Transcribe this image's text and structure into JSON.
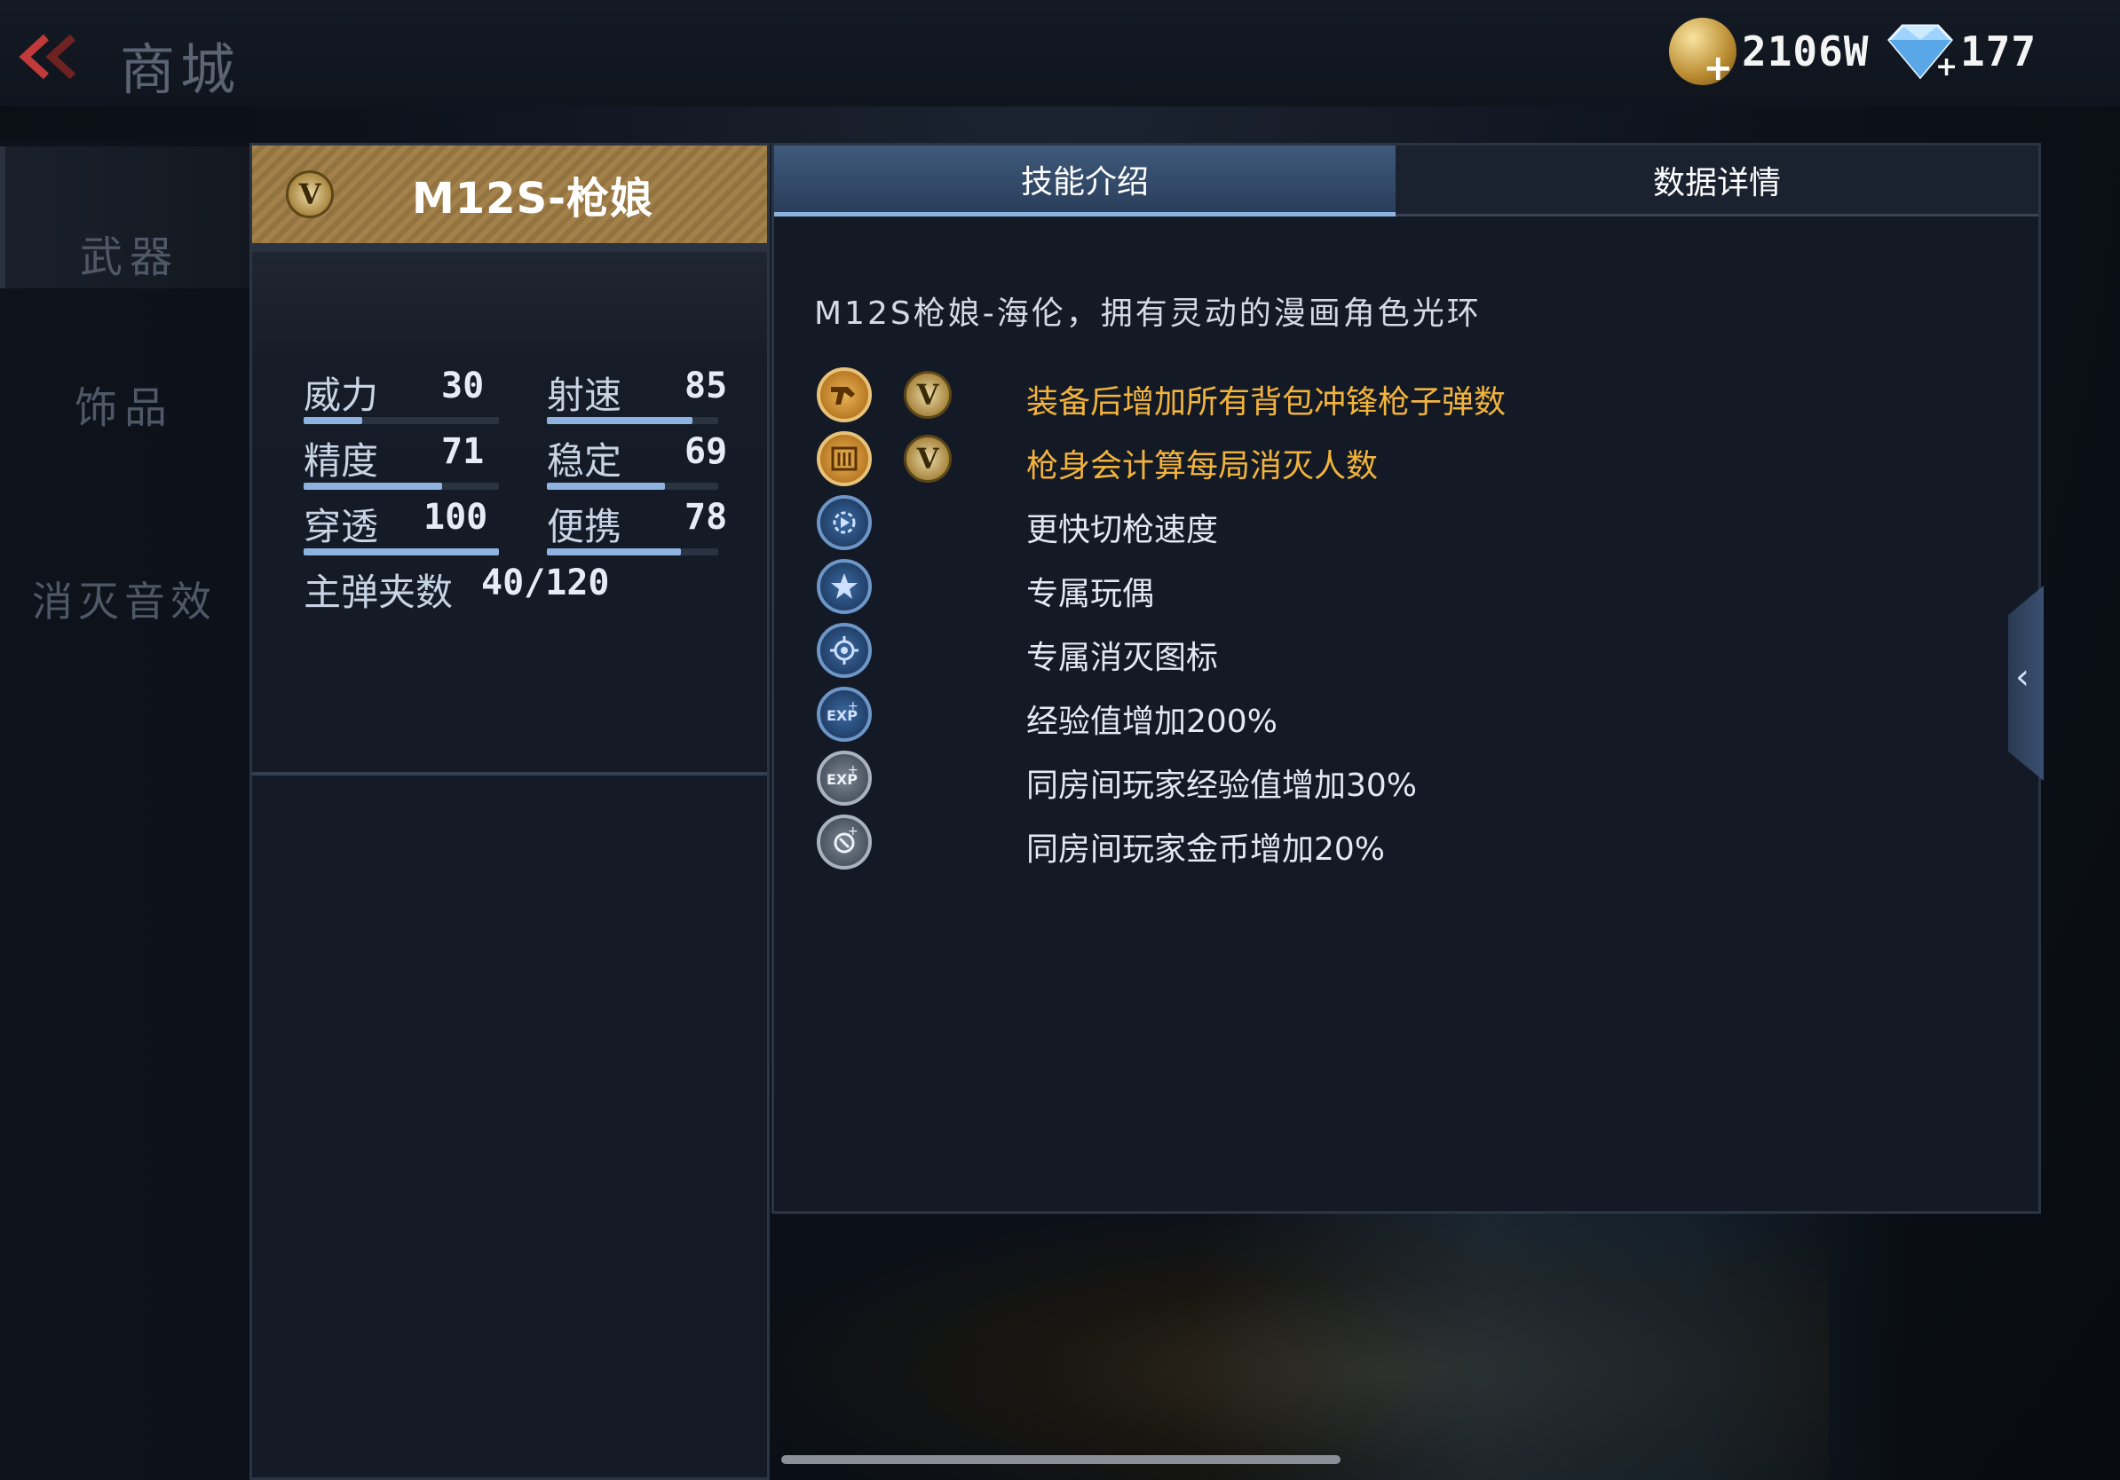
{
  "header": {
    "title": "商城",
    "coins": "2106W",
    "diamonds": "177"
  },
  "sidebar": {
    "items": [
      {
        "label": "武器"
      },
      {
        "label": "饰品"
      },
      {
        "label": "消灭音效"
      }
    ]
  },
  "weapon": {
    "badge": "V",
    "name": "M12S-枪娘",
    "stats": [
      {
        "label": "威力",
        "value": "30",
        "fill": 0.3
      },
      {
        "label": "射速",
        "value": "85",
        "fill": 0.85
      },
      {
        "label": "精度",
        "value": "71",
        "fill": 0.71
      },
      {
        "label": "稳定",
        "value": "69",
        "fill": 0.69
      },
      {
        "label": "穿透",
        "value": "100",
        "fill": 1.0
      },
      {
        "label": "便携",
        "value": "78",
        "fill": 0.78
      }
    ],
    "ammo_label": "主弹夹数",
    "ammo_value": "40/120"
  },
  "tabs": [
    {
      "label": "技能介绍",
      "active": true
    },
    {
      "label": "数据详情",
      "active": false
    }
  ],
  "skills": {
    "description": "M12S枪娘-海伦，拥有灵动的漫画角色光环",
    "items": [
      {
        "text": "装备后增加所有背包冲锋枪子弹数",
        "icon": "gun-icon",
        "style": "gold",
        "vip": "V"
      },
      {
        "text": "枪身会计算每局消灭人数",
        "icon": "counter-icon",
        "style": "gold",
        "vip": "V"
      },
      {
        "text": "更快切枪速度",
        "icon": "swap-speed-icon",
        "style": "blue"
      },
      {
        "text": "专属玩偶",
        "icon": "star-icon",
        "style": "blue"
      },
      {
        "text": "专属消灭图标",
        "icon": "kill-mark-icon",
        "style": "blue"
      },
      {
        "text": "经验值增加200%",
        "icon": "exp-icon",
        "style": "blue"
      },
      {
        "text": "同房间玩家经验值增加30%",
        "icon": "room-exp-icon",
        "style": "grey"
      },
      {
        "text": "同房间玩家金币增加20%",
        "icon": "room-coin-icon",
        "style": "grey"
      }
    ]
  },
  "colors": {
    "accent_gold": "#f2b33d",
    "tab_active": "#3f5a7c",
    "bar_fill": "#8fb3e0"
  }
}
